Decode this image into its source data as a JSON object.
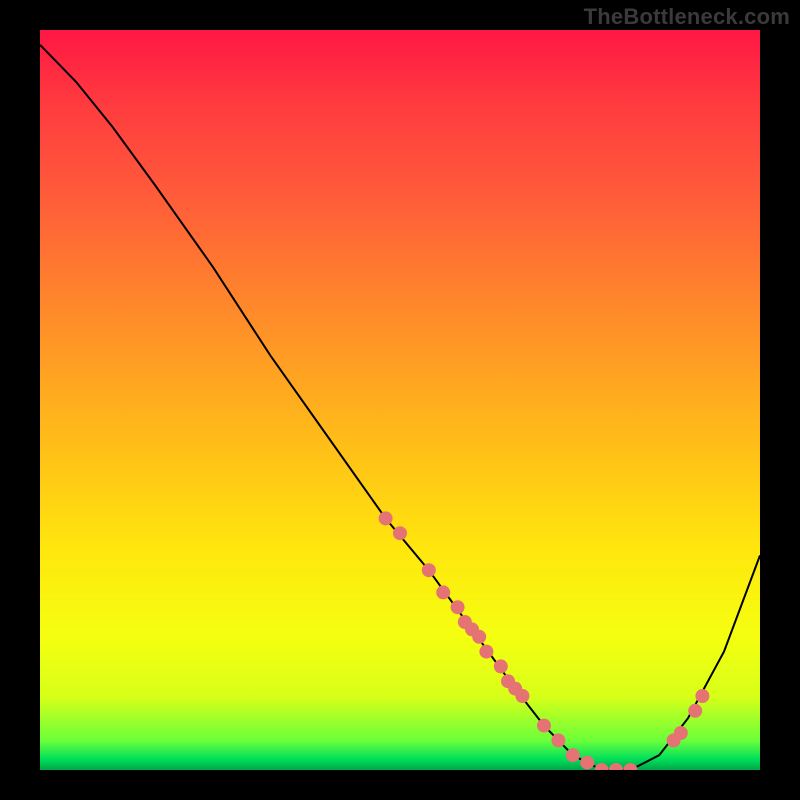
{
  "watermark": "TheBottleneck.com",
  "chart_data": {
    "type": "line",
    "title": "",
    "xlabel": "",
    "ylabel": "",
    "xlim": [
      0,
      100
    ],
    "ylim": [
      0,
      100
    ],
    "curve": {
      "x": [
        0,
        5,
        10,
        16,
        24,
        32,
        40,
        48,
        54,
        60,
        66,
        70,
        74,
        78,
        82,
        86,
        90,
        95,
        100
      ],
      "y": [
        98,
        93,
        87,
        79,
        68,
        56,
        45,
        34,
        27,
        19,
        11,
        6,
        2,
        0,
        0,
        2,
        7,
        16,
        29
      ]
    },
    "markers": {
      "x": [
        48,
        50,
        54,
        56,
        58,
        59,
        60,
        61,
        62,
        64,
        65,
        66,
        67,
        70,
        72,
        74,
        76,
        78,
        80,
        82,
        88,
        89,
        91,
        92
      ],
      "y": [
        34,
        32,
        27,
        24,
        22,
        20,
        19,
        18,
        16,
        14,
        12,
        11,
        10,
        6,
        4,
        2,
        1,
        0,
        0,
        0,
        4,
        5,
        8,
        10
      ]
    },
    "marker_color": "#e57373",
    "curve_color": "#000000"
  }
}
